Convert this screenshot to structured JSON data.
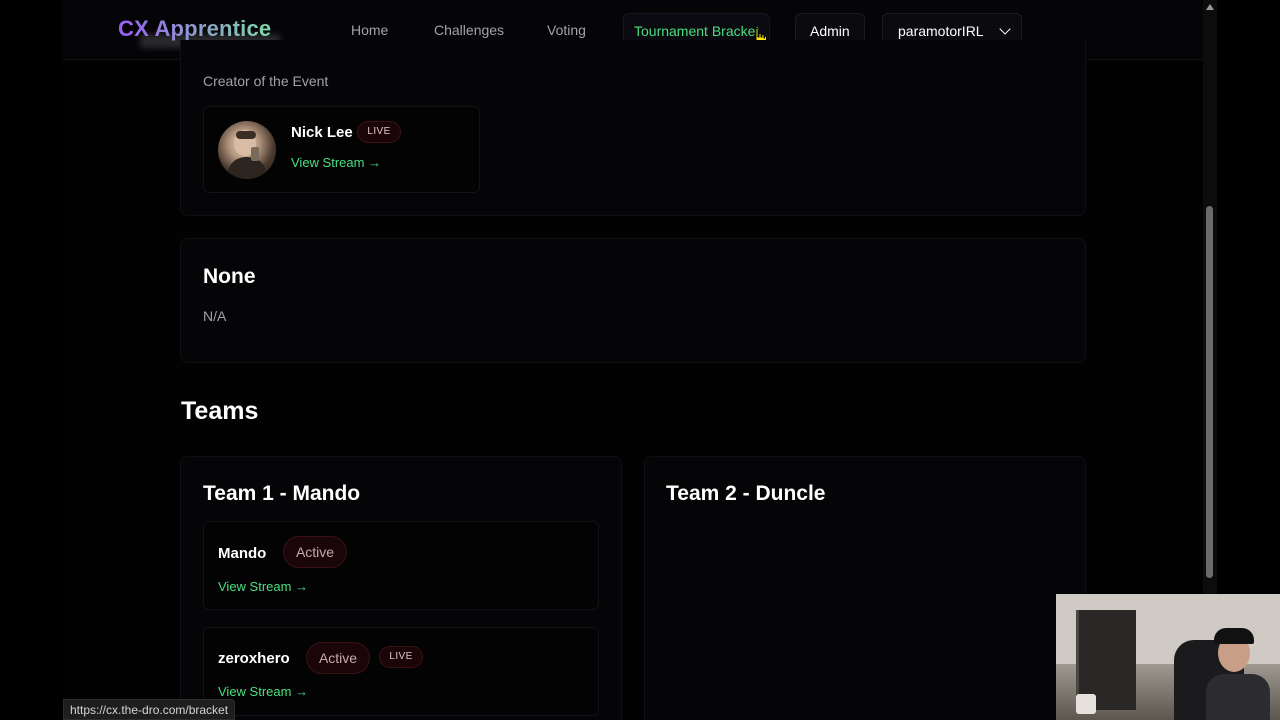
{
  "nav": {
    "brand": "CX Apprentice",
    "links": {
      "home": "Home",
      "challenges": "Challenges",
      "voting": "Voting",
      "bracket": "Tournament Bracket"
    },
    "admin": "Admin",
    "user": "paramotorIRL",
    "active_color": "#4ade80"
  },
  "creator_section": {
    "subtitle": "Creator of the Event",
    "streamer": {
      "name": "Nick Lee",
      "badge": "LIVE",
      "link": "View Stream →"
    }
  },
  "none_section": {
    "title": "None",
    "value": "N/A"
  },
  "teams": {
    "heading": "Teams",
    "list": [
      {
        "title": "Team 1 - Mando",
        "members": [
          {
            "name": "Mando",
            "status": "Active",
            "link": "View Stream →"
          },
          {
            "name": "zeroxhero",
            "status": "Active",
            "badge": "LIVE",
            "link": "View Stream →"
          }
        ]
      },
      {
        "title": "Team 2 - Duncle",
        "members": []
      }
    ]
  },
  "status_bar": {
    "url": "https://cx.the-dro.com/bracket"
  }
}
